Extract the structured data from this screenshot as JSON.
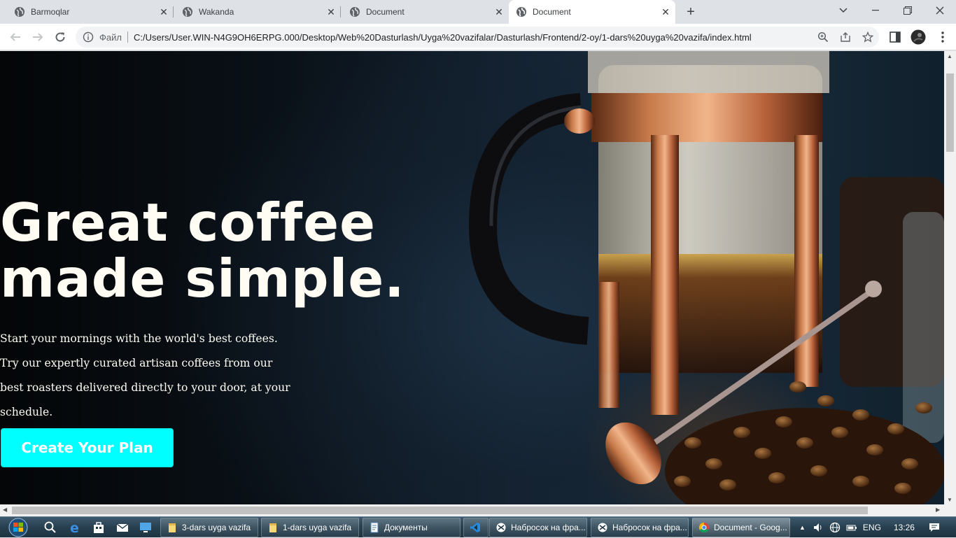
{
  "browser": {
    "tabs": [
      {
        "title": "Barmoqlar",
        "active": false
      },
      {
        "title": "Wakanda",
        "active": false
      },
      {
        "title": "Document",
        "active": false
      },
      {
        "title": "Document",
        "active": true
      }
    ],
    "new_tab_label": "+",
    "address": {
      "scheme_label": "Файл",
      "url": "C:/Users/User.WIN-N4G9OH6ERPG.000/Desktop/Web%20Dasturlash/Uyga%20vazifalar/Dasturlash/Frontend/2-oy/1-dars%20uyga%20vazifa/index.html"
    }
  },
  "page": {
    "hero": {
      "title_line1": "Great coffee",
      "title_line2": "made simple.",
      "text": "Start your mornings with the world's best coffees. Try our expertly curated artisan coffees from our best roasters delivered directly to your door, at your schedule.",
      "cta_label": "Create Your Plan"
    },
    "colors": {
      "cta_background": "#00ffff",
      "title": "#fefcf3"
    }
  },
  "taskbar": {
    "tasks": [
      {
        "label": "3-dars uyga vazifa",
        "icon": "folder-icon"
      },
      {
        "label": "1-dars uyga vazifa",
        "icon": "folder-icon"
      },
      {
        "label": "Документы",
        "icon": "document-icon"
      },
      {
        "label": "",
        "icon": "vscode-icon"
      },
      {
        "label": "Набросок на фра...",
        "icon": "snipping-icon"
      },
      {
        "label": "Набросок на фра...",
        "icon": "snipping-icon"
      },
      {
        "label": "Document - Goog...",
        "icon": "chrome-icon"
      }
    ],
    "tray": {
      "language": "ENG",
      "time": "13:26"
    }
  }
}
